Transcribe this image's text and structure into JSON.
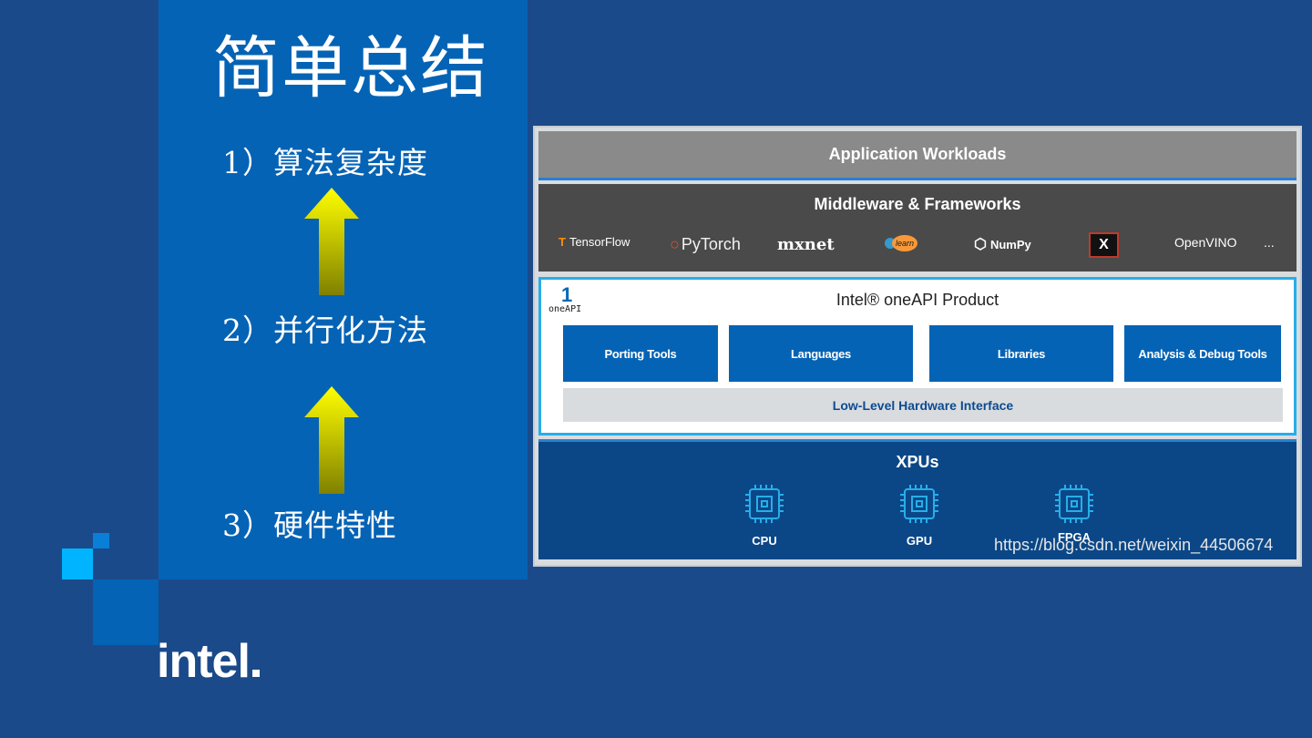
{
  "slide": {
    "title": "简单总结",
    "steps": [
      "1）算法复杂度",
      "2）并行化方法",
      "3）硬件特性"
    ]
  },
  "brand": {
    "logo_text": "intel"
  },
  "diagram": {
    "application_layer": "Application Workloads",
    "middleware": {
      "title": "Middleware & Frameworks",
      "frameworks": [
        "TensorFlow",
        "PyTorch",
        "mxnet",
        "learn",
        "NumPy",
        "X",
        "OpenVINO",
        "..."
      ]
    },
    "oneapi": {
      "badge_number": "1",
      "badge_text": "oneAPI",
      "title": "Intel® oneAPI Product",
      "tools": [
        "Porting Tools",
        "Languages",
        "Libraries",
        "Analysis & Debug Tools"
      ],
      "low_level": "Low-Level Hardware Interface"
    },
    "xpus": {
      "title": "XPUs",
      "devices": [
        "CPU",
        "GPU",
        "FPGA"
      ]
    },
    "watermark": "https://blog.csdn.net/weixin_44506674"
  },
  "colors": {
    "background": "#1b4a8a",
    "panel": "#0563b5",
    "accent_cyan": "#00b4ff",
    "arrow_top": "#ffff00",
    "arrow_bottom": "#808000",
    "tool_blue": "#0563b5"
  }
}
